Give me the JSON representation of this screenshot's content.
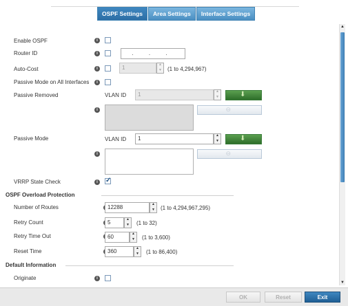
{
  "tabs": [
    "OSPF Settings",
    "Area Settings",
    "Interface Settings"
  ],
  "form": {
    "enable_ospf": {
      "label": "Enable OSPF",
      "checked": false
    },
    "router_id": {
      "label": "Router ID",
      "value": ". . ."
    },
    "auto_cost": {
      "label": "Auto-Cost",
      "value": "1",
      "hint": "(1 to 4,294,967)"
    },
    "passive_all": {
      "label": "Passive Mode on All Interfaces"
    },
    "passive_removed": {
      "label": "Passive Removed",
      "vlan_label": "VLAN ID",
      "vlan_value": "1"
    },
    "passive_mode": {
      "label": "Passive Mode",
      "vlan_label": "VLAN ID",
      "vlan_value": "1"
    },
    "vrrp": {
      "label": "VRRP State Check",
      "checked": true
    }
  },
  "overload": {
    "title": "OSPF Overload Protection",
    "routes": {
      "label": "Number of Routes",
      "value": "12288",
      "hint": "(1 to 4,294,967,295)"
    },
    "retry_count": {
      "label": "Retry Count",
      "value": "5",
      "hint": "(1 to 32)"
    },
    "retry_timeout": {
      "label": "Retry Time Out",
      "value": "60",
      "hint": "(1 to 3,600)"
    },
    "reset_time": {
      "label": "Reset Time",
      "value": "360",
      "hint": "(1 to 86,400)"
    }
  },
  "default_info": {
    "title": "Default Information",
    "originate": {
      "label": "Originate"
    }
  },
  "footer": {
    "ok": "OK",
    "reset": "Reset",
    "exit": "Exit"
  }
}
